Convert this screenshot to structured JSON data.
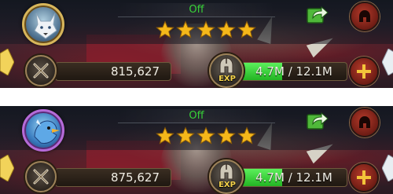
{
  "panels": [
    {
      "status": "Off",
      "stars": 5,
      "power": "815,627",
      "exp_label": "EXP",
      "exp_text": "4.7M / 12.1M",
      "exp_fraction": 0.39,
      "avatar": "white-wolf-avatar",
      "avatar_ring": "#d8b65a"
    },
    {
      "status": "Off",
      "stars": 5,
      "power": "875,627",
      "exp_label": "EXP",
      "exp_text": "4.7M / 12.1M",
      "exp_fraction": 0.39,
      "avatar": "blue-bird-avatar",
      "avatar_ring": "#b66ad8"
    }
  ],
  "colors": {
    "status_green": "#38d238",
    "star_gold": "#f5b81a",
    "exp_green": "#3ddc3d",
    "button_red": "#9a2a1e"
  },
  "icons": [
    "share-icon",
    "helmet-icon",
    "crossed-swords-icon",
    "exp-helmet-icon",
    "plus-icon",
    "gem-icon",
    "star-icon"
  ]
}
